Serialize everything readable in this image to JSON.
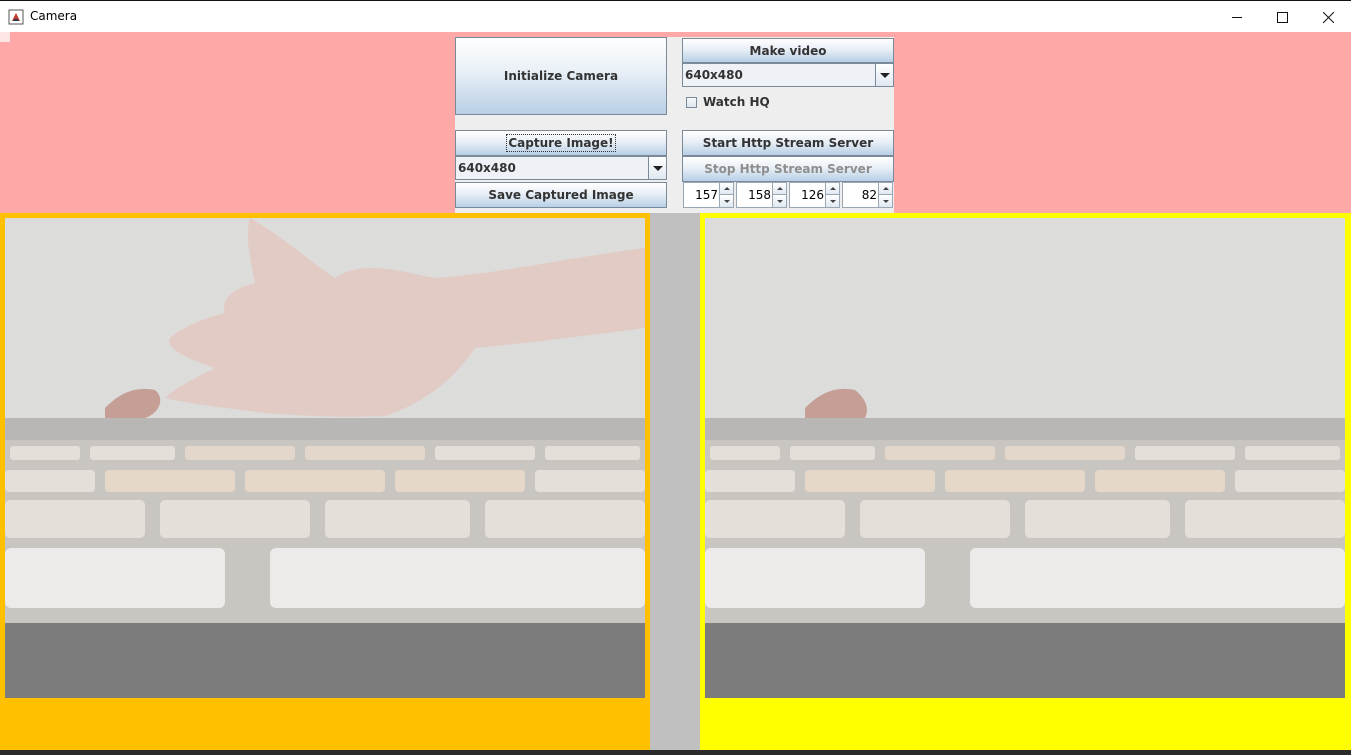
{
  "window": {
    "title": "Camera",
    "controls": [
      "minimize",
      "maximize",
      "close"
    ]
  },
  "toolbar": {
    "initialize_label": "Initialize Camera",
    "make_video_label": "Make video",
    "video_resolution": "640x480",
    "watch_hq_label": "Watch HQ",
    "watch_hq_checked": false,
    "capture_label": "Capture Image!",
    "capture_resolution": "640x480",
    "save_label": "Save Captured Image",
    "start_stream_label": "Start Http Stream Server",
    "stop_stream_label": "Stop Http Stream Server",
    "stop_stream_enabled": false,
    "spinners": [
      "157",
      "158",
      "126",
      "82"
    ]
  },
  "colors": {
    "controls_bg": "#ffa8a8",
    "left_panel_border": "#ffc000",
    "right_panel_border": "#ffff00",
    "divider": "#c0c0c0"
  },
  "panels": {
    "left": "live camera feed",
    "right": "captured image"
  }
}
